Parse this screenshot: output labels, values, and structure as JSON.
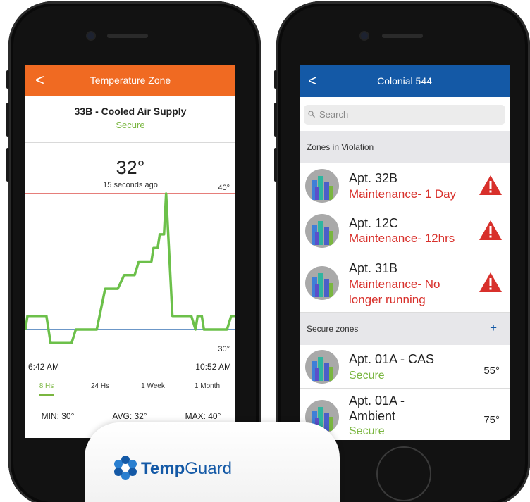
{
  "left": {
    "header_title": "Temperature Zone",
    "back": "<",
    "zone_name": "33B - Cooled Air Supply",
    "zone_status": "Secure",
    "current_temp": "32°",
    "updated": "15 seconds ago",
    "upper_limit_label": "40°",
    "lower_limit_label": "30°",
    "time_start": "6:42 AM",
    "time_end": "10:52 AM",
    "ranges": [
      "8 Hs",
      "24 Hs",
      "1 Week",
      "1 Month"
    ],
    "active_range": "8 Hs",
    "min": "MIN: 30°",
    "avg": "AVG: 32°",
    "max": "MAX: 40°",
    "colors": {
      "header": "#f06a22",
      "line": "#6cc04a",
      "upper": "#d8302b",
      "lower": "#1459a6"
    }
  },
  "chart_data": {
    "type": "line",
    "title": "",
    "xlabel": "",
    "ylabel": "",
    "xlim": [
      "6:42 AM",
      "10:52 AM"
    ],
    "ylim": [
      29,
      41
    ],
    "thresholds": {
      "upper": 40,
      "lower": 30
    },
    "series": [
      {
        "x": [
          0,
          0.01,
          0.1,
          0.12,
          0.22,
          0.24,
          0.34,
          0.38,
          0.44,
          0.47,
          0.52,
          0.54,
          0.6,
          0.61,
          0.63,
          0.64,
          0.66,
          0.67,
          0.7,
          0.72,
          0.79,
          0.81,
          0.82,
          0.84,
          0.85,
          0.96,
          0.98,
          1.0
        ],
        "values": [
          30,
          31,
          31,
          29,
          29,
          30,
          30,
          33,
          33,
          34,
          34,
          35,
          35,
          36,
          36,
          37,
          37,
          40,
          31,
          31,
          31,
          30,
          31,
          31,
          30,
          30,
          31,
          31
        ]
      }
    ]
  },
  "right": {
    "header_title": "Colonial 544",
    "back": "<",
    "search_placeholder": "Search",
    "violation_header": "Zones in Violation",
    "violations": [
      {
        "name": "Apt. 32B",
        "status": "Maintenance- 1 Day"
      },
      {
        "name": "Apt. 12C",
        "status": "Maintenance- 12hrs"
      },
      {
        "name": "Apt. 31B",
        "status_line1": "Maintenance- No",
        "status_line2": "longer running"
      }
    ],
    "secure_header": "Secure zones",
    "plus": "+",
    "secure": [
      {
        "name": "Apt. 01A - CAS",
        "status": "Secure",
        "temp": "55°"
      },
      {
        "name_line1": "Apt. 01A -",
        "name_line2": "Ambient",
        "status": "Secure",
        "temp": "75°"
      }
    ]
  },
  "card": {
    "brand_bold": "Temp",
    "brand_light": "Guard"
  }
}
